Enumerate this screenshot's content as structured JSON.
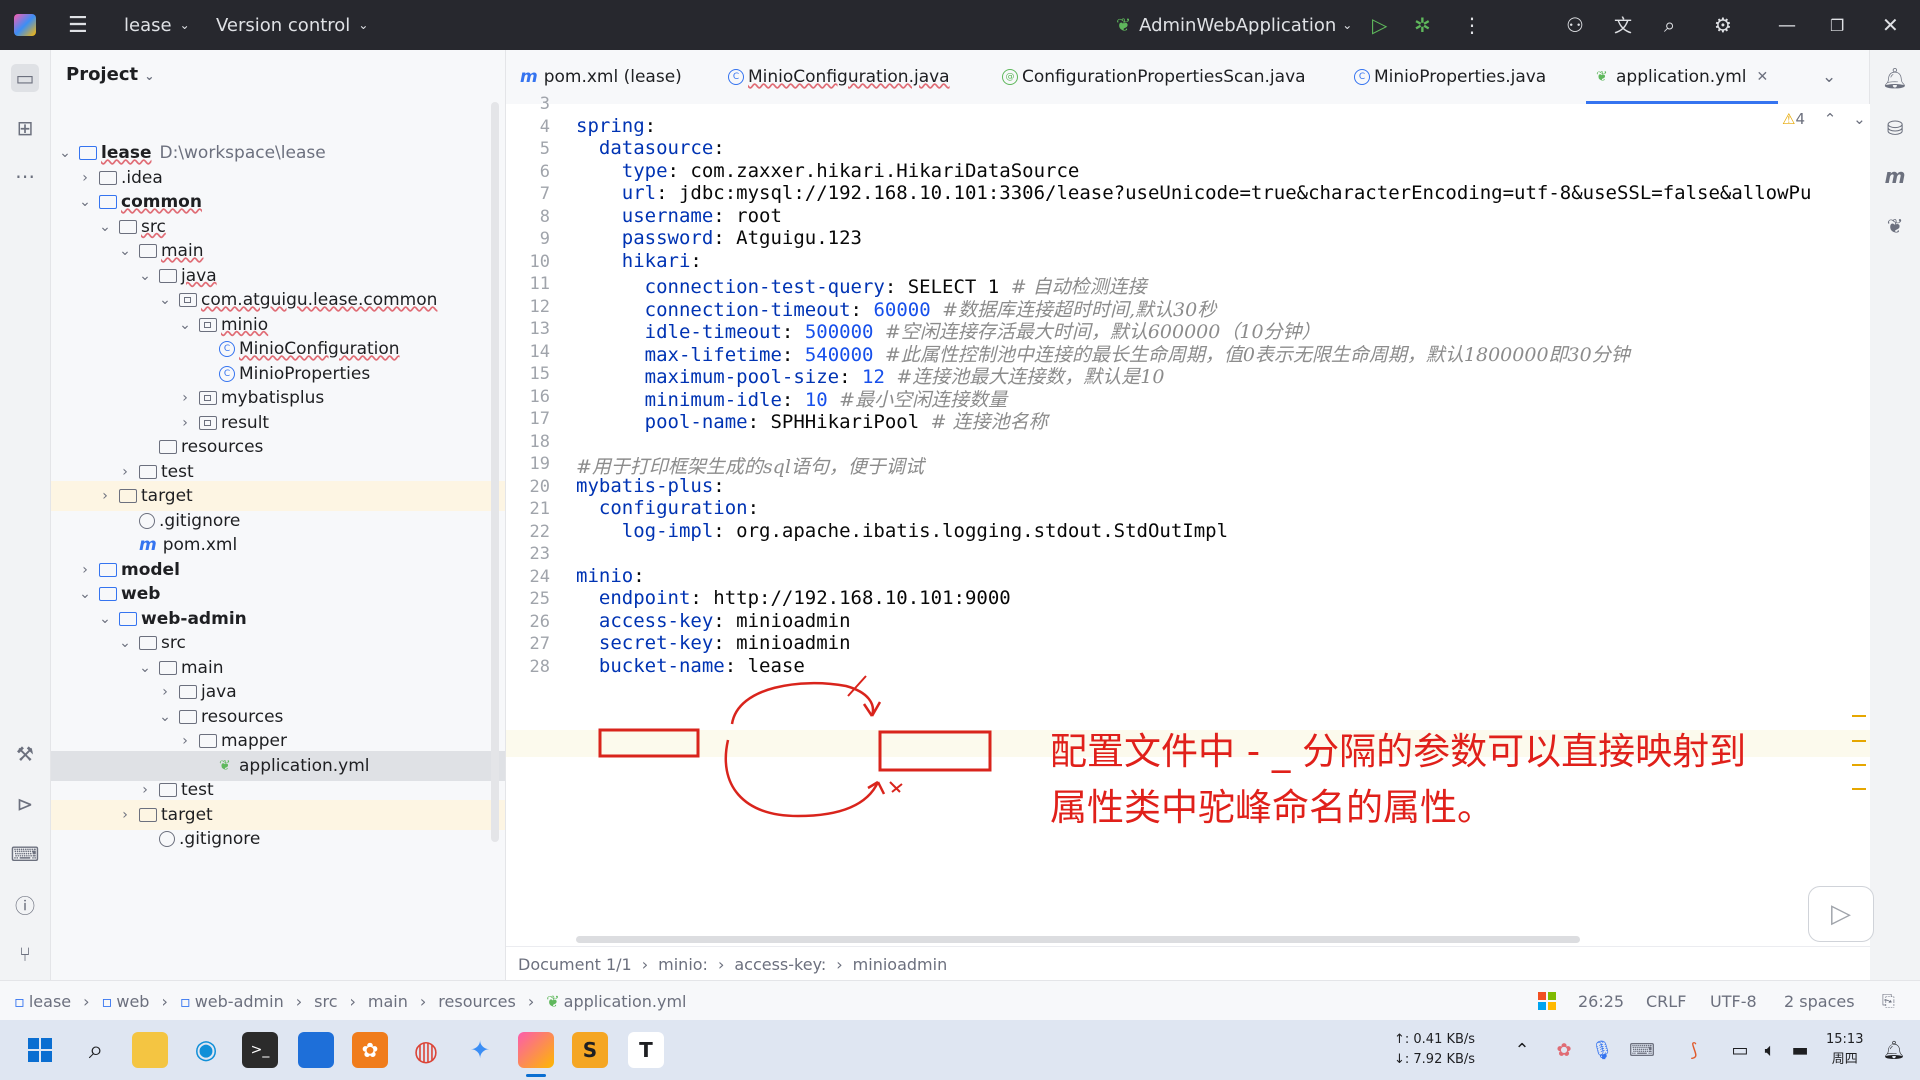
{
  "titlebar": {
    "project": "lease",
    "vcs": "Version control",
    "run_config": "AdminWebApplication"
  },
  "project_panel": {
    "title": "Project",
    "tree": [
      {
        "label": "lease",
        "muted": "D:\\workspace\\lease",
        "depth": 0,
        "chev": "down",
        "icon": "module",
        "bold": true
      },
      {
        "label": ".idea",
        "depth": 1,
        "chev": "right",
        "icon": "folder"
      },
      {
        "label": "common",
        "depth": 1,
        "chev": "down",
        "icon": "module",
        "bold": true
      },
      {
        "label": "src",
        "depth": 2,
        "chev": "down",
        "icon": "folder"
      },
      {
        "label": "main",
        "depth": 3,
        "chev": "down",
        "icon": "folder"
      },
      {
        "label": "java",
        "depth": 4,
        "chev": "down",
        "icon": "folder"
      },
      {
        "label": "com.atguigu.lease.common",
        "depth": 5,
        "chev": "down",
        "icon": "package"
      },
      {
        "label": "minio",
        "depth": 6,
        "chev": "down",
        "icon": "package"
      },
      {
        "label": "MinioConfiguration",
        "depth": 7,
        "chev": "",
        "icon": "class"
      },
      {
        "label": "MinioProperties",
        "depth": 7,
        "chev": "",
        "icon": "class"
      },
      {
        "label": "mybatisplus",
        "depth": 6,
        "chev": "right",
        "icon": "package"
      },
      {
        "label": "result",
        "depth": 6,
        "chev": "right",
        "icon": "package"
      },
      {
        "label": "resources",
        "depth": 4,
        "chev": "",
        "icon": "folder"
      },
      {
        "label": "test",
        "depth": 3,
        "chev": "right",
        "icon": "folder"
      },
      {
        "label": "target",
        "depth": 2,
        "chev": "right",
        "icon": "folder",
        "hl": "target"
      },
      {
        "label": ".gitignore",
        "depth": 3,
        "chev": "",
        "icon": "ignore"
      },
      {
        "label": "pom.xml",
        "depth": 3,
        "chev": "",
        "icon": "maven"
      },
      {
        "label": "model",
        "depth": 1,
        "chev": "right",
        "icon": "module",
        "bold": true
      },
      {
        "label": "web",
        "depth": 1,
        "chev": "down",
        "icon": "module",
        "bold": true
      },
      {
        "label": "web-admin",
        "depth": 2,
        "chev": "down",
        "icon": "module",
        "bold": true
      },
      {
        "label": "src",
        "depth": 3,
        "chev": "down",
        "icon": "folder"
      },
      {
        "label": "main",
        "depth": 4,
        "chev": "down",
        "icon": "folder"
      },
      {
        "label": "java",
        "depth": 5,
        "chev": "right",
        "icon": "folder"
      },
      {
        "label": "resources",
        "depth": 5,
        "chev": "down",
        "icon": "folder"
      },
      {
        "label": "mapper",
        "depth": 6,
        "chev": "right",
        "icon": "folder"
      },
      {
        "label": "application.yml",
        "depth": 7,
        "chev": "",
        "icon": "yml",
        "hl": "selected"
      },
      {
        "label": "test",
        "depth": 4,
        "chev": "right",
        "icon": "folder"
      },
      {
        "label": "target",
        "depth": 3,
        "chev": "right",
        "icon": "folder",
        "hl": "target"
      },
      {
        "label": ".gitignore",
        "depth": 4,
        "chev": "",
        "icon": "ignore"
      }
    ]
  },
  "tabs": [
    {
      "label": "pom.xml (lease)",
      "icon": "maven"
    },
    {
      "label": "MinioConfiguration.java",
      "icon": "class"
    },
    {
      "label": "ConfigurationPropertiesScan.java",
      "icon": "annotation"
    },
    {
      "label": "MinioProperties.java",
      "icon": "class"
    },
    {
      "label": "application.yml",
      "icon": "yml",
      "active": true
    }
  ],
  "editor": {
    "warnings": "4",
    "lines": [
      {
        "n": "3",
        "segs": []
      },
      {
        "n": "4",
        "segs": [
          [
            "k",
            "spring"
          ],
          [
            "p",
            ":"
          ]
        ]
      },
      {
        "n": "5",
        "segs": [
          [
            "p",
            "  "
          ],
          [
            "k",
            "datasource"
          ],
          [
            "p",
            ":"
          ]
        ]
      },
      {
        "n": "6",
        "segs": [
          [
            "p",
            "    "
          ],
          [
            "k",
            "type"
          ],
          [
            "p",
            ": com.zaxxer.hikari.HikariDataSource"
          ]
        ]
      },
      {
        "n": "7",
        "segs": [
          [
            "p",
            "    "
          ],
          [
            "k",
            "url"
          ],
          [
            "p",
            ": jdbc:mysql://192.168.10.101:3306/lease?useUnicode=true&characterEncoding=utf-8&useSSL=false&allowPu"
          ]
        ]
      },
      {
        "n": "8",
        "segs": [
          [
            "p",
            "    "
          ],
          [
            "k",
            "username"
          ],
          [
            "p",
            ": root"
          ]
        ]
      },
      {
        "n": "9",
        "segs": [
          [
            "p",
            "    "
          ],
          [
            "k",
            "password"
          ],
          [
            "p",
            ": Atguigu.123"
          ]
        ]
      },
      {
        "n": "10",
        "segs": [
          [
            "p",
            "    "
          ],
          [
            "k",
            "hikari"
          ],
          [
            "p",
            ":"
          ]
        ]
      },
      {
        "n": "11",
        "segs": [
          [
            "p",
            "      "
          ],
          [
            "k",
            "connection-test-query"
          ],
          [
            "p",
            ": SELECT 1 "
          ],
          [
            "c",
            "# 自动检测连接"
          ]
        ]
      },
      {
        "n": "12",
        "segs": [
          [
            "p",
            "      "
          ],
          [
            "k",
            "connection-timeout"
          ],
          [
            "p",
            ": "
          ],
          [
            "n",
            "60000"
          ],
          [
            "p",
            " "
          ],
          [
            "c",
            "#数据库连接超时时间,默认30秒"
          ]
        ]
      },
      {
        "n": "13",
        "segs": [
          [
            "p",
            "      "
          ],
          [
            "k",
            "idle-timeout"
          ],
          [
            "p",
            ": "
          ],
          [
            "n",
            "500000"
          ],
          [
            "p",
            " "
          ],
          [
            "c",
            "#空闲连接存活最大时间，默认600000（10分钟）"
          ]
        ]
      },
      {
        "n": "14",
        "segs": [
          [
            "p",
            "      "
          ],
          [
            "k",
            "max-lifetime"
          ],
          [
            "p",
            ": "
          ],
          [
            "n",
            "540000"
          ],
          [
            "p",
            " "
          ],
          [
            "c",
            "#此属性控制池中连接的最长生命周期，值0表示无限生命周期，默认1800000即30分钟"
          ]
        ]
      },
      {
        "n": "15",
        "segs": [
          [
            "p",
            "      "
          ],
          [
            "k",
            "maximum-pool-size"
          ],
          [
            "p",
            ": "
          ],
          [
            "n",
            "12"
          ],
          [
            "p",
            " "
          ],
          [
            "c",
            "#连接池最大连接数，默认是10"
          ]
        ]
      },
      {
        "n": "16",
        "segs": [
          [
            "p",
            "      "
          ],
          [
            "k",
            "minimum-idle"
          ],
          [
            "p",
            ": "
          ],
          [
            "n",
            "10"
          ],
          [
            "p",
            " "
          ],
          [
            "c",
            "#最小空闲连接数量"
          ]
        ]
      },
      {
        "n": "17",
        "segs": [
          [
            "p",
            "      "
          ],
          [
            "k",
            "pool-name"
          ],
          [
            "p",
            ": SPHHikariPool "
          ],
          [
            "c",
            "# 连接池名称"
          ]
        ]
      },
      {
        "n": "18",
        "segs": []
      },
      {
        "n": "19",
        "segs": [
          [
            "c",
            "#用于打印框架生成的sql语句，便于调试"
          ]
        ]
      },
      {
        "n": "20",
        "segs": [
          [
            "k",
            "mybatis-plus"
          ],
          [
            "p",
            ":"
          ]
        ]
      },
      {
        "n": "21",
        "segs": [
          [
            "p",
            "  "
          ],
          [
            "k",
            "configuration"
          ],
          [
            "p",
            ":"
          ]
        ]
      },
      {
        "n": "22",
        "segs": [
          [
            "p",
            "    "
          ],
          [
            "k",
            "log-impl"
          ],
          [
            "p",
            ": org.apache.ibatis.logging.stdout.StdOutImpl"
          ]
        ]
      },
      {
        "n": "23",
        "segs": []
      },
      {
        "n": "24",
        "segs": [
          [
            "k",
            "minio"
          ],
          [
            "p",
            ":"
          ]
        ]
      },
      {
        "n": "25",
        "segs": [
          [
            "p",
            "  "
          ],
          [
            "k",
            "endpoint"
          ],
          [
            "p",
            ": http://192.168.10.101:9000"
          ]
        ]
      },
      {
        "n": "26",
        "segs": [
          [
            "p",
            "  "
          ],
          [
            "k",
            "access-key"
          ],
          [
            "p",
            ": minioadmin"
          ]
        ]
      },
      {
        "n": "27",
        "segs": [
          [
            "p",
            "  "
          ],
          [
            "k",
            "secret-key"
          ],
          [
            "p",
            ": minioadmin"
          ]
        ]
      },
      {
        "n": "28",
        "segs": [
          [
            "p",
            "  "
          ],
          [
            "k",
            "bucket-name"
          ],
          [
            "p",
            ": lease"
          ]
        ]
      }
    ]
  },
  "annotation": {
    "line1": "配置文件中 - _ 分隔的参数可以直接映射到",
    "line2": "属性类中驼峰命名的属性。"
  },
  "editor_breadcrumb": [
    "Document 1/1",
    "minio:",
    "access-key:",
    "minioadmin"
  ],
  "nav_path": [
    "lease",
    "web",
    "web-admin",
    "src",
    "main",
    "resources",
    "application.yml"
  ],
  "status": {
    "position": "26:25",
    "line_sep": "CRLF",
    "encoding": "UTF-8",
    "indent": "2 spaces"
  },
  "taskbar": {
    "net_up": "↑: 0.41 KB/s",
    "net_down": "↓: 7.92 KB/s",
    "time": "15:13",
    "day": "周四"
  }
}
